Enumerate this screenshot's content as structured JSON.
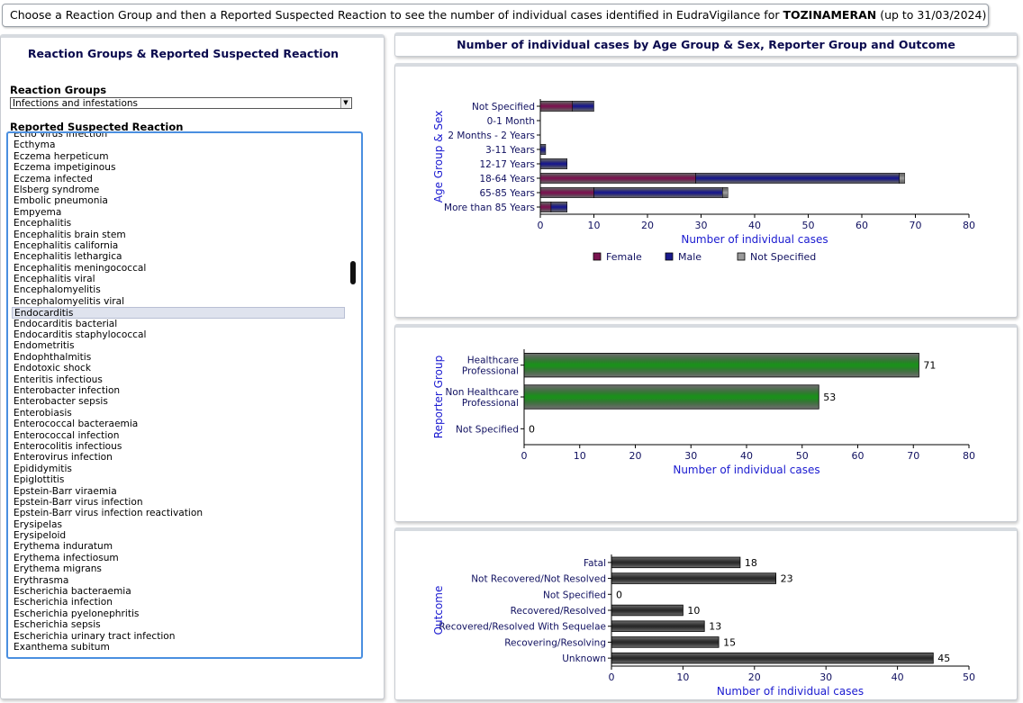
{
  "top_bar": {
    "text_before": "Choose a Reaction Group and then a Reported Suspected Reaction to see the number of individual cases identified in EudraVigilance for ",
    "product": "TOZINAMERAN",
    "text_after": " (up to 31/03/2024)"
  },
  "left_panel": {
    "title": "Reaction Groups & Reported Suspected Reaction",
    "reaction_groups_label": "Reaction Groups",
    "reaction_group_selected": "Infections and infestations",
    "reported_reaction_label": "Reported Suspected Reaction",
    "reactions": [
      "Echo virus infection",
      "Ecthyma",
      "Eczema herpeticum",
      "Eczema impetiginous",
      "Eczema infected",
      "Elsberg syndrome",
      "Embolic pneumonia",
      "Empyema",
      "Encephalitis",
      "Encephalitis brain stem",
      "Encephalitis california",
      "Encephalitis lethargica",
      "Encephalitis meningococcal",
      "Encephalitis viral",
      "Encephalomyelitis",
      "Encephalomyelitis viral",
      "Endocarditis",
      "Endocarditis bacterial",
      "Endocarditis staphylococcal",
      "Endometritis",
      "Endophthalmitis",
      "Endotoxic shock",
      "Enteritis infectious",
      "Enterobacter infection",
      "Enterobacter sepsis",
      "Enterobiasis",
      "Enterococcal bacteraemia",
      "Enterococcal infection",
      "Enterocolitis infectious",
      "Enterovirus infection",
      "Epididymitis",
      "Epiglottitis",
      "Epstein-Barr viraemia",
      "Epstein-Barr virus infection",
      "Epstein-Barr virus infection reactivation",
      "Erysipelas",
      "Erysipeloid",
      "Erythema induratum",
      "Erythema infectiosum",
      "Erythema migrans",
      "Erythrasma",
      "Escherichia bacteraemia",
      "Escherichia infection",
      "Escherichia pyelonephritis",
      "Escherichia sepsis",
      "Escherichia urinary tract infection",
      "Exanthema subitum"
    ],
    "selected_reaction": "Endocarditis"
  },
  "right_header": {
    "title": "Number of individual cases by Age Group & Sex, Reporter Group and Outcome"
  },
  "colors": {
    "female": "#7a1450",
    "male": "#1a1a8c",
    "not_specified": "#9a9a9a",
    "reporter": "#1c8f1c",
    "outcome": "#2a2a2a",
    "axis_text": "#1a1ad0",
    "tick_text": "#101060"
  },
  "chart_data": [
    {
      "type": "bar",
      "orientation": "horizontal",
      "stacked": true,
      "ylabel": "Age Group & Sex",
      "xlabel": "Number of individual cases",
      "categories": [
        "Not Specified",
        "0-1 Month",
        "2 Months - 2 Years",
        "3-11 Years",
        "12-17 Years",
        "18-64 Years",
        "65-85 Years",
        "More than 85 Years"
      ],
      "series": [
        {
          "name": "Female",
          "values": [
            6,
            0,
            0,
            0,
            0,
            29,
            10,
            2
          ]
        },
        {
          "name": "Male",
          "values": [
            4,
            0,
            0,
            1,
            5,
            38,
            24,
            3
          ]
        },
        {
          "name": "Not Specified",
          "values": [
            0,
            0,
            0,
            0,
            0,
            1,
            1,
            0
          ]
        }
      ],
      "xlim": [
        0,
        80
      ],
      "xticks": [
        0,
        10,
        20,
        30,
        40,
        50,
        60,
        70,
        80
      ],
      "legend": "bottom"
    },
    {
      "type": "bar",
      "orientation": "horizontal",
      "ylabel": "Reporter Group",
      "xlabel": "Number of individual cases",
      "categories": [
        [
          "Healthcare",
          "Professional"
        ],
        [
          "Non Healthcare",
          "Professional"
        ],
        [
          "Not Specified"
        ]
      ],
      "values": [
        71,
        53,
        0
      ],
      "xlim": [
        0,
        80
      ],
      "xticks": [
        0,
        10,
        20,
        30,
        40,
        50,
        60,
        70,
        80
      ]
    },
    {
      "type": "bar",
      "orientation": "horizontal",
      "ylabel": "Outcome",
      "xlabel": "Number of individual cases",
      "categories": [
        "Fatal",
        "Not Recovered/Not Resolved",
        "Not Specified",
        "Recovered/Resolved",
        "Recovered/Resolved With Sequelae",
        "Recovering/Resolving",
        "Unknown"
      ],
      "values": [
        18,
        23,
        0,
        10,
        13,
        15,
        45
      ],
      "xlim": [
        0,
        50
      ],
      "xticks": [
        0,
        10,
        20,
        30,
        40,
        50
      ]
    }
  ]
}
